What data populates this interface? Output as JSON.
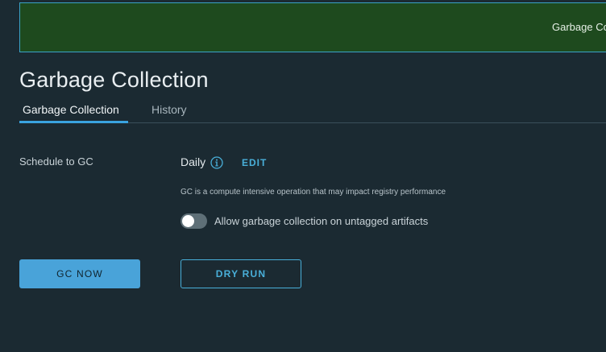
{
  "banner": {
    "text": "Garbage Collection"
  },
  "page": {
    "title": "Garbage Collection"
  },
  "tabs": [
    {
      "label": "Garbage Collection",
      "active": true
    },
    {
      "label": "History",
      "active": false
    }
  ],
  "schedule": {
    "label": "Schedule to GC",
    "value": "Daily",
    "info_icon": "info-icon",
    "edit_label": "EDIT",
    "note": "GC is a compute intensive operation that may impact registry performance"
  },
  "untagged_toggle": {
    "label": "Allow garbage collection on untagged artifacts",
    "checked": false
  },
  "actions": {
    "gc_now_label": "GC NOW",
    "dry_run_label": "DRY RUN"
  },
  "colors": {
    "background": "#1b2a32",
    "banner_bg": "#1e4a1e",
    "accent": "#49afd9",
    "primary_button": "#49a3d9"
  }
}
